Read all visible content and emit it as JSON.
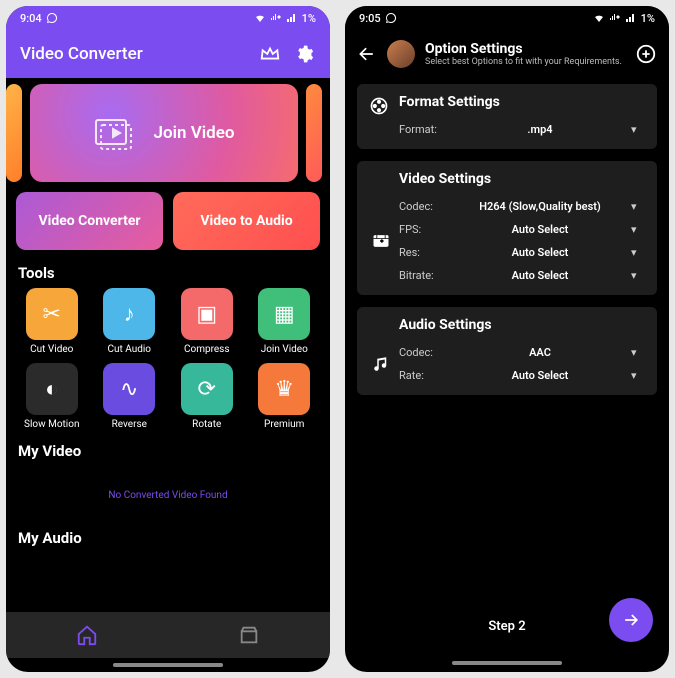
{
  "left": {
    "status": {
      "time": "9:04",
      "battery": "1%"
    },
    "appbar": {
      "title": "Video Converter"
    },
    "hero": {
      "label": "Join Video"
    },
    "duo": {
      "a": "Video Converter",
      "b": "Video to Audio"
    },
    "sections": {
      "tools": "Tools",
      "myvideo": "My Video",
      "myaudio": "My Audio"
    },
    "tools": [
      {
        "label": "Cut Video",
        "color": "#f7a63a"
      },
      {
        "label": "Cut Audio",
        "color": "#4cb7e8"
      },
      {
        "label": "Compress",
        "color": "#f46a6a"
      },
      {
        "label": "Join Video",
        "color": "#3fbf7a"
      },
      {
        "label": "Slow Motion",
        "color": "#2b2b2b"
      },
      {
        "label": "Reverse",
        "color": "#6a4de0"
      },
      {
        "label": "Rotate",
        "color": "#37b89a"
      },
      {
        "label": "Premium",
        "color": "#f4793a"
      }
    ],
    "empty": "No Converted Video Found"
  },
  "right": {
    "status": {
      "time": "9:05",
      "battery": "1%"
    },
    "header": {
      "title": "Option Settings",
      "sub": "Select best Options to fit with your Requirements."
    },
    "format": {
      "title": "Format Settings",
      "row": {
        "label": "Format:",
        "value": ".mp4"
      }
    },
    "video": {
      "title": "Video Settings",
      "rows": [
        {
          "label": "Codec:",
          "value": "H264 (Slow,Quality best)"
        },
        {
          "label": "FPS:",
          "value": "Auto Select"
        },
        {
          "label": "Res:",
          "value": "Auto Select"
        },
        {
          "label": "Bitrate:",
          "value": "Auto Select"
        }
      ]
    },
    "audio": {
      "title": "Audio Settings",
      "rows": [
        {
          "label": "Codec:",
          "value": "AAC"
        },
        {
          "label": "Rate:",
          "value": "Auto Select"
        }
      ]
    },
    "step": "Step 2"
  }
}
